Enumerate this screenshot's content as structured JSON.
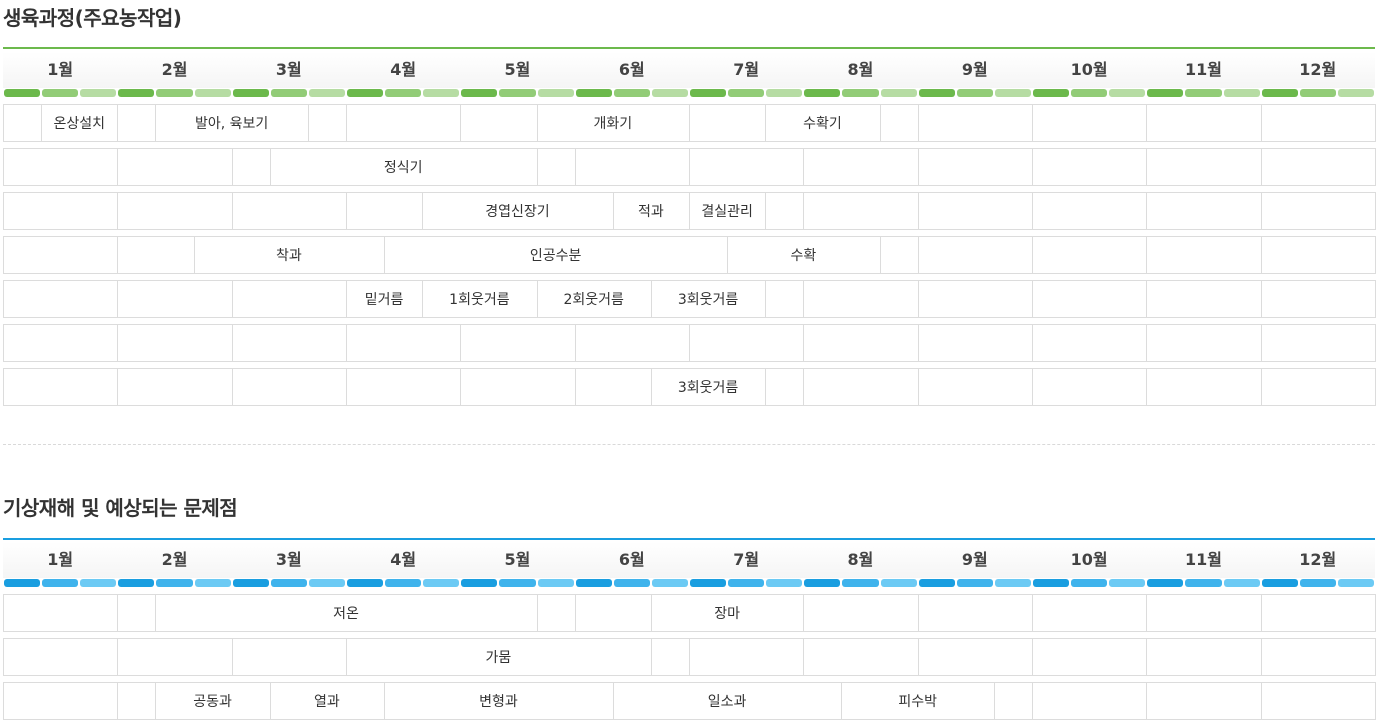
{
  "sections": [
    {
      "title": "생육과정(주요농작업)",
      "colors": {
        "line": "#6cb94c",
        "segments": [
          "#6cb94c",
          "#92cc77",
          "#b6dca3"
        ]
      },
      "months": [
        "1월",
        "2월",
        "3월",
        "4월",
        "5월",
        "6월",
        "7월",
        "8월",
        "9월",
        "10월",
        "11월",
        "12월"
      ],
      "rows": [
        {
          "tasks": [
            {
              "label": "온상설치",
              "s": 1,
              "e": 3
            },
            {
              "label": "발아, 육보기",
              "s": 4,
              "e": 8
            },
            {
              "label": "개화기",
              "s": 14,
              "e": 18
            },
            {
              "label": "수확기",
              "s": 20,
              "e": 23
            }
          ]
        },
        {
          "tasks": [
            {
              "label": "정식기",
              "s": 7,
              "e": 14
            }
          ]
        },
        {
          "tasks": [
            {
              "label": "경엽신장기",
              "s": 11,
              "e": 16
            },
            {
              "label": "적과",
              "s": 16,
              "e": 18
            },
            {
              "label": "결실관리",
              "s": 18,
              "e": 20
            }
          ]
        },
        {
          "tasks": [
            {
              "label": "착과",
              "s": 5,
              "e": 10
            },
            {
              "label": "인공수분",
              "s": 10,
              "e": 19
            },
            {
              "label": "수확",
              "s": 19,
              "e": 23
            }
          ]
        },
        {
          "tasks": [
            {
              "label": "밑거름",
              "s": 9,
              "e": 11
            },
            {
              "label": "1회웃거름",
              "s": 11,
              "e": 14
            },
            {
              "label": "2회웃거름",
              "s": 14,
              "e": 17
            },
            {
              "label": "3회웃거름",
              "s": 17,
              "e": 20
            }
          ]
        },
        {
          "tasks": []
        },
        {
          "tasks": [
            {
              "label": "3회웃거름",
              "s": 17,
              "e": 20
            }
          ]
        }
      ]
    },
    {
      "title": "기상재해 및 예상되는 문제점",
      "colors": {
        "line": "#1a9ee0",
        "segments": [
          "#1a9ee0",
          "#3fb3ec",
          "#6ccaf4"
        ]
      },
      "months": [
        "1월",
        "2월",
        "3월",
        "4월",
        "5월",
        "6월",
        "7월",
        "8월",
        "9월",
        "10월",
        "11월",
        "12월"
      ],
      "rows": [
        {
          "tasks": [
            {
              "label": "저온",
              "s": 4,
              "e": 14
            },
            {
              "label": "장마",
              "s": 17,
              "e": 21
            }
          ]
        },
        {
          "tasks": [
            {
              "label": "가뭄",
              "s": 9,
              "e": 17
            }
          ]
        },
        {
          "tasks": [
            {
              "label": "공동과",
              "s": 4,
              "e": 7
            },
            {
              "label": "열과",
              "s": 7,
              "e": 10
            },
            {
              "label": "변형과",
              "s": 10,
              "e": 16
            },
            {
              "label": "일소과",
              "s": 16,
              "e": 22
            },
            {
              "label": "피수박",
              "s": 22,
              "e": 26
            }
          ]
        }
      ]
    }
  ]
}
